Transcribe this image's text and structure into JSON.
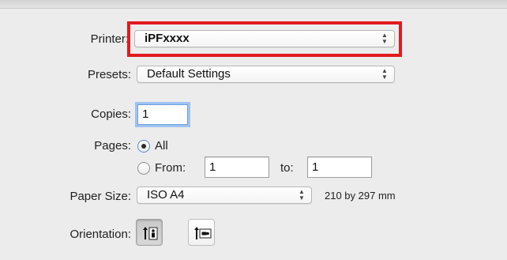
{
  "printer": {
    "label": "Printer:",
    "value": "iPFxxxx",
    "highlight_color": "#e11a1f"
  },
  "presets": {
    "label": "Presets:",
    "value": "Default Settings"
  },
  "copies": {
    "label": "Copies:",
    "value": "1"
  },
  "pages": {
    "label": "Pages:",
    "all_label": "All",
    "all_selected": true,
    "from_label": "From:",
    "from_value": "1",
    "to_label": "to:",
    "to_value": "1"
  },
  "paper_size": {
    "label": "Paper Size:",
    "value": "ISO A4",
    "dimensions": "210 by 297 mm"
  },
  "orientation": {
    "label": "Orientation:",
    "options": [
      {
        "name": "portrait",
        "icon": "portrait-orientation-icon",
        "selected": true
      },
      {
        "name": "landscape",
        "icon": "landscape-orientation-icon",
        "selected": false
      }
    ]
  }
}
